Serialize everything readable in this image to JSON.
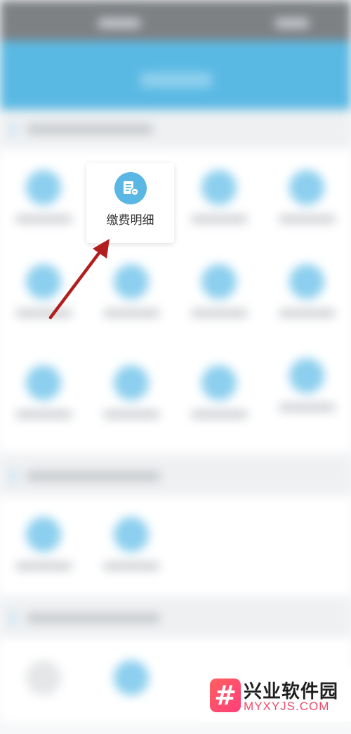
{
  "popup": {
    "label": "缴费明细",
    "icon": "payment-document-icon",
    "accent_color": "#5ab6e3"
  },
  "annotation": {
    "arrow_color": "#b21e1e"
  },
  "header": {
    "color": "#5ab9e3"
  },
  "watermark": {
    "brand_cn": "兴业软件园",
    "brand_en": "MYXYJS.COM",
    "logo_glyph": "#",
    "logo_color": "#ff4d6d"
  }
}
